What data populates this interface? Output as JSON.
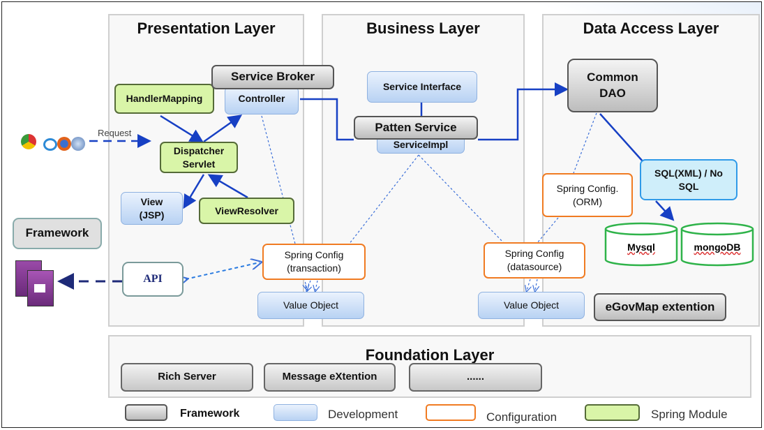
{
  "layers": {
    "presentation": "Presentation Layer",
    "business": "Business Layer",
    "data_access": "Data Access Layer",
    "foundation": "Foundation Layer"
  },
  "presentation": {
    "service_broker": "Service Broker",
    "handler_mapping": "HandlerMapping",
    "controller": "Controller",
    "dispatcher": "Dispatcher Servlet",
    "view": "View (JSP)",
    "view_resolver": "ViewResolver",
    "spring_config": "Spring Config (transaction)",
    "value_object": "Value Object",
    "api": "API",
    "request": "Request"
  },
  "business": {
    "service_interface": "Service Interface",
    "patten_service": "Patten Service",
    "service_impl": "ServiceImpl",
    "spring_config": "Spring Config (datasource)",
    "value_object": "Value Object"
  },
  "data_access": {
    "common_dao": "Common DAO",
    "sql": "SQL(XML) / No SQL",
    "spring_config_orm": "Spring Config. (ORM)",
    "mysql": "Mysql",
    "mongodb": "mongoDB",
    "egovmap": "eGovMap extention"
  },
  "framework_label": "Framework",
  "foundation": {
    "items": [
      "Rich Server",
      "Message eXtention",
      "......"
    ]
  },
  "legend": [
    {
      "label": "Framework",
      "color": "#c8c8c8"
    },
    {
      "label": "Development",
      "color": "#b8d2f3"
    },
    {
      "label": "Configuration",
      "color": "#f07b22"
    },
    {
      "label": "Spring Module",
      "color": "#d9f5a8"
    }
  ],
  "icons": [
    "browser-icons",
    "robot-client-icon"
  ]
}
